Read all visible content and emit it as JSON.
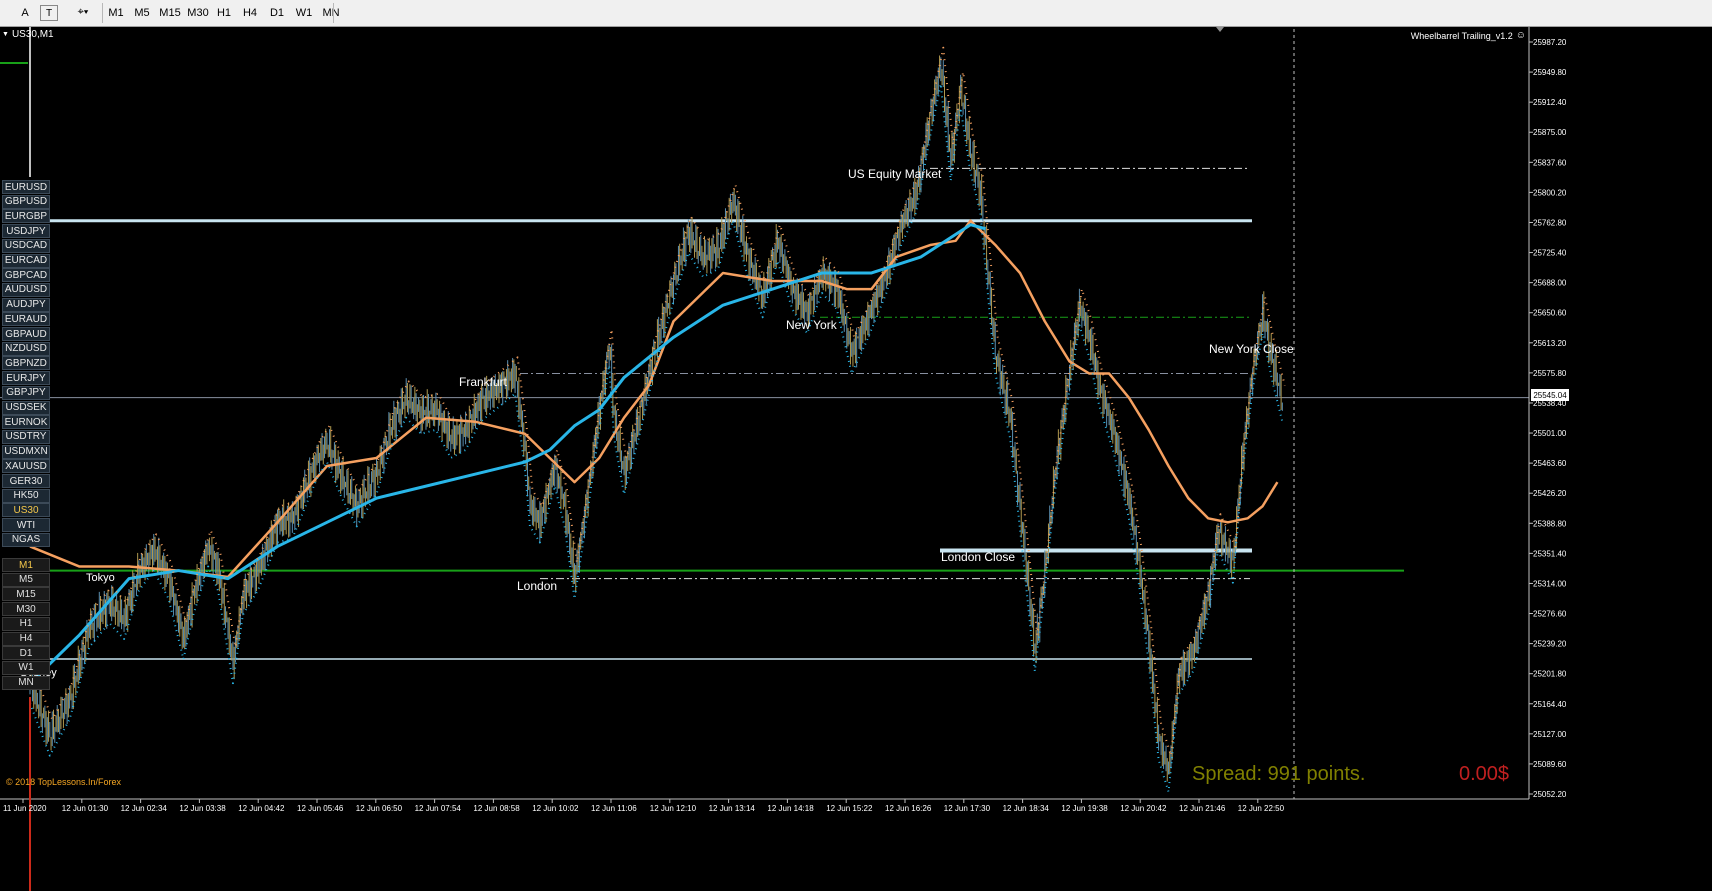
{
  "toolbar": {
    "tools": [
      {
        "name": "text-tool-icon",
        "label": "A"
      },
      {
        "name": "text-label-tool-icon",
        "label": "T"
      },
      {
        "name": "shapes-tool-icon",
        "label": "⌖▾"
      }
    ],
    "timeframes": [
      "M1",
      "M5",
      "M15",
      "M30",
      "H1",
      "H4",
      "D1",
      "W1",
      "MN"
    ]
  },
  "chart": {
    "symbol_label": "US30,M1",
    "indicator_label": "Wheelbarrel Trailing_v1.2",
    "copyright": "© 2018 TopLessons.In/Forex",
    "spread": "Spread: 991 points.",
    "profit": "0.00$",
    "current_price": "25545.04",
    "price_covered": "25538.49",
    "sessions": {
      "tokyo": "Tokyo",
      "sydney": "Sydney",
      "london": "London",
      "frankfurt": "Frankfurt",
      "new_york": "New York",
      "us_equity": "US Equity Market",
      "london_close": "London Close",
      "new_york_close": "New York Close"
    }
  },
  "symbols": [
    "EURUSD",
    "GBPUSD",
    "EURGBP",
    "USDJPY",
    "USDCAD",
    "EURCAD",
    "GBPCAD",
    "AUDUSD",
    "AUDJPY",
    "EURAUD",
    "GBPAUD",
    "NZDUSD",
    "GBPNZD",
    "EURJPY",
    "GBPJPY",
    "USDSEK",
    "EURNOK",
    "USDTRY",
    "USDMXN",
    "XAUUSD",
    "GER30",
    "HK50",
    "US30",
    "WTI",
    "NGAS"
  ],
  "active_symbol": "US30",
  "panel_timeframes": [
    "M1",
    "M5",
    "M15",
    "M30",
    "H1",
    "H4",
    "D1",
    "W1",
    "MN"
  ],
  "active_timeframe": "M1",
  "colors": {
    "background": "#000000",
    "candles": "#b09a50",
    "candles_alt": "#5b8fb0",
    "fast_ma": "#f5a060",
    "slow_ma": "#29b6e8",
    "level_light": "#c8e4f0",
    "level_green": "#18a018",
    "axis_text": "#ffffff",
    "spread_text": "#808000",
    "profit_text": "#c02020"
  },
  "chart_data": {
    "type": "line",
    "y_ticks": [
      "25987.20",
      "25949.80",
      "25912.40",
      "25875.00",
      "25837.60",
      "25800.20",
      "25762.80",
      "25725.40",
      "25688.00",
      "25650.60",
      "25613.20",
      "25575.80",
      "25538.40",
      "25501.00",
      "25463.60",
      "25426.20",
      "25388.80",
      "25351.40",
      "25314.00",
      "25276.60",
      "25239.20",
      "25201.80",
      "25164.40",
      "25127.00",
      "25089.60",
      "25052.20"
    ],
    "x_ticks": [
      "11 Jun 2020",
      "12 Jun 01:30",
      "12 Jun 02:34",
      "12 Jun 03:38",
      "12 Jun 04:42",
      "12 Jun 05:46",
      "12 Jun 06:50",
      "12 Jun 07:54",
      "12 Jun 08:58",
      "12 Jun 10:02",
      "12 Jun 11:06",
      "12 Jun 12:10",
      "12 Jun 13:14",
      "12 Jun 14:18",
      "12 Jun 15:22",
      "12 Jun 16:26",
      "12 Jun 17:30",
      "12 Jun 18:34",
      "12 Jun 19:38",
      "12 Jun 20:42",
      "12 Jun 21:46",
      "12 Jun 22:50"
    ],
    "ylim": [
      25052.2,
      25987.2
    ],
    "price_series": [
      [
        0,
        25190
      ],
      [
        4,
        25125
      ],
      [
        8,
        25170
      ],
      [
        12,
        25260
      ],
      [
        16,
        25290
      ],
      [
        19,
        25270
      ],
      [
        22,
        25330
      ],
      [
        25,
        25355
      ],
      [
        28,
        25320
      ],
      [
        31,
        25245
      ],
      [
        33,
        25300
      ],
      [
        36,
        25360
      ],
      [
        38,
        25330
      ],
      [
        41,
        25215
      ],
      [
        43,
        25300
      ],
      [
        46,
        25330
      ],
      [
        50,
        25390
      ],
      [
        53,
        25395
      ],
      [
        56,
        25440
      ],
      [
        58,
        25470
      ],
      [
        60,
        25490
      ],
      [
        63,
        25445
      ],
      [
        66,
        25410
      ],
      [
        70,
        25450
      ],
      [
        73,
        25510
      ],
      [
        76,
        25545
      ],
      [
        79,
        25525
      ],
      [
        82,
        25530
      ],
      [
        85,
        25495
      ],
      [
        88,
        25505
      ],
      [
        91,
        25540
      ],
      [
        95,
        25560
      ],
      [
        98,
        25575
      ],
      [
        100,
        25480
      ],
      [
        101,
        25410
      ],
      [
        103,
        25390
      ],
      [
        106,
        25460
      ],
      [
        108,
        25410
      ],
      [
        110,
        25320
      ],
      [
        112,
        25400
      ],
      [
        115,
        25530
      ],
      [
        117,
        25610
      ],
      [
        118,
        25520
      ],
      [
        120,
        25450
      ],
      [
        123,
        25520
      ],
      [
        126,
        25600
      ],
      [
        130,
        25690
      ],
      [
        133,
        25750
      ],
      [
        136,
        25720
      ],
      [
        139,
        25730
      ],
      [
        142,
        25790
      ],
      [
        145,
        25720
      ],
      [
        148,
        25670
      ],
      [
        151,
        25740
      ],
      [
        154,
        25680
      ],
      [
        157,
        25650
      ],
      [
        160,
        25700
      ],
      [
        163,
        25680
      ],
      [
        166,
        25600
      ],
      [
        169,
        25640
      ],
      [
        173,
        25700
      ],
      [
        176,
        25760
      ],
      [
        179,
        25800
      ],
      [
        182,
        25900
      ],
      [
        184,
        25960
      ],
      [
        186,
        25840
      ],
      [
        188,
        25930
      ],
      [
        190,
        25850
      ],
      [
        192,
        25800
      ],
      [
        195,
        25600
      ],
      [
        198,
        25520
      ],
      [
        201,
        25350
      ],
      [
        203,
        25230
      ],
      [
        205,
        25330
      ],
      [
        207,
        25450
      ],
      [
        210,
        25580
      ],
      [
        212,
        25660
      ],
      [
        214,
        25620
      ],
      [
        216,
        25560
      ],
      [
        219,
        25500
      ],
      [
        222,
        25420
      ],
      [
        224,
        25340
      ],
      [
        226,
        25240
      ],
      [
        228,
        25120
      ],
      [
        230,
        25080
      ],
      [
        232,
        25200
      ],
      [
        235,
        25230
      ],
      [
        238,
        25300
      ],
      [
        240,
        25380
      ],
      [
        243,
        25340
      ],
      [
        245,
        25480
      ],
      [
        247,
        25580
      ],
      [
        249,
        25650
      ],
      [
        251,
        25590
      ],
      [
        253,
        25540
      ]
    ],
    "fast_ma": [
      [
        0,
        25360
      ],
      [
        10,
        25335
      ],
      [
        20,
        25335
      ],
      [
        30,
        25330
      ],
      [
        40,
        25322
      ],
      [
        50,
        25390
      ],
      [
        60,
        25460
      ],
      [
        70,
        25470
      ],
      [
        80,
        25520
      ],
      [
        90,
        25515
      ],
      [
        100,
        25500
      ],
      [
        105,
        25470
      ],
      [
        110,
        25440
      ],
      [
        115,
        25470
      ],
      [
        120,
        25520
      ],
      [
        125,
        25560
      ],
      [
        130,
        25640
      ],
      [
        140,
        25700
      ],
      [
        150,
        25690
      ],
      [
        160,
        25690
      ],
      [
        165,
        25680
      ],
      [
        170,
        25680
      ],
      [
        175,
        25720
      ],
      [
        182,
        25735
      ],
      [
        187,
        25740
      ],
      [
        190,
        25765
      ],
      [
        195,
        25735
      ],
      [
        200,
        25700
      ],
      [
        205,
        25640
      ],
      [
        210,
        25590
      ],
      [
        214,
        25575
      ],
      [
        218,
        25575
      ],
      [
        222,
        25545
      ],
      [
        226,
        25505
      ],
      [
        230,
        25460
      ],
      [
        234,
        25420
      ],
      [
        238,
        25395
      ],
      [
        242,
        25390
      ],
      [
        246,
        25395
      ],
      [
        249,
        25410
      ],
      [
        252,
        25440
      ]
    ],
    "slow_ma": [
      [
        0,
        25190
      ],
      [
        10,
        25250
      ],
      [
        20,
        25320
      ],
      [
        30,
        25330
      ],
      [
        40,
        25320
      ],
      [
        50,
        25360
      ],
      [
        60,
        25390
      ],
      [
        70,
        25420
      ],
      [
        80,
        25435
      ],
      [
        90,
        25450
      ],
      [
        100,
        25465
      ],
      [
        105,
        25480
      ],
      [
        110,
        25510
      ],
      [
        115,
        25530
      ],
      [
        120,
        25570
      ],
      [
        130,
        25620
      ],
      [
        140,
        25660
      ],
      [
        150,
        25680
      ],
      [
        160,
        25700
      ],
      [
        170,
        25700
      ],
      [
        180,
        25720
      ],
      [
        190,
        25760
      ],
      [
        193,
        25755
      ]
    ],
    "levels": [
      {
        "price": 25765,
        "style": "solid",
        "color": "light"
      },
      {
        "price": 25355,
        "style": "solid",
        "color": "light"
      },
      {
        "price": 25330,
        "style": "solid",
        "color": "green"
      },
      {
        "price": 25220,
        "style": "solid",
        "color": "light"
      },
      {
        "price": 25545.04,
        "style": "solid",
        "color": "grey"
      },
      {
        "price": 25830,
        "style": "dashdot",
        "color": "white"
      },
      {
        "price": 25645,
        "style": "dashdot",
        "color": "green"
      },
      {
        "price": 25575,
        "style": "dashdot",
        "color": "grey"
      },
      {
        "price": 25320,
        "style": "dashdot",
        "color": "white"
      }
    ]
  }
}
